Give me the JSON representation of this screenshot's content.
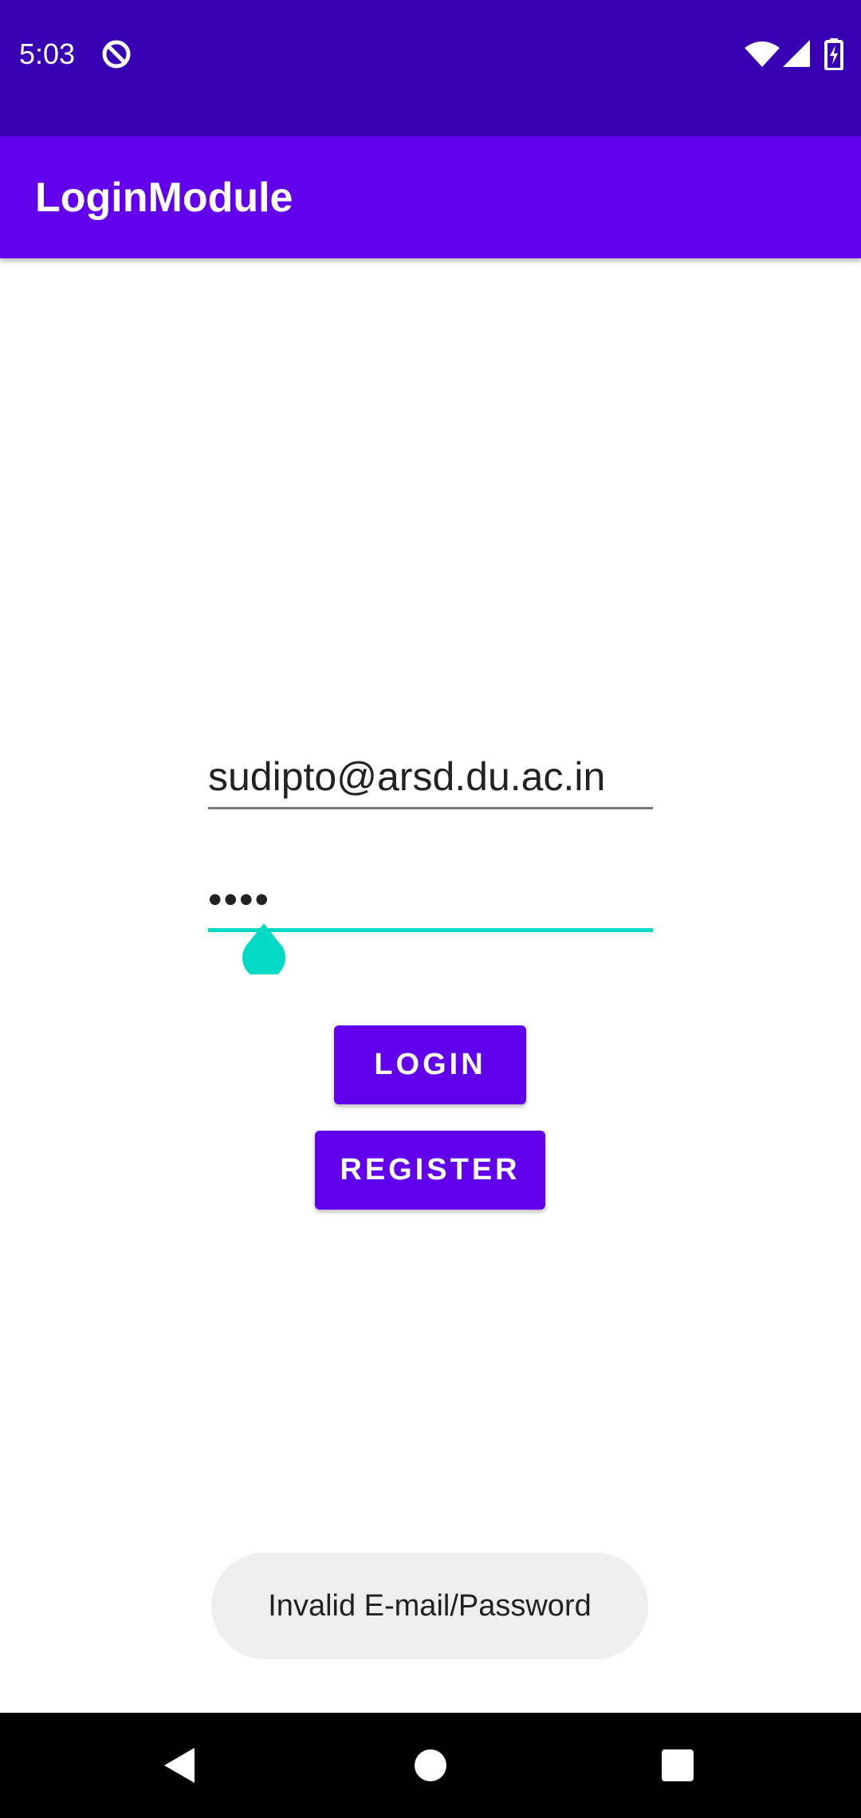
{
  "status_bar": {
    "time": "5:03",
    "icons": [
      "do-not-disturb-icon",
      "wifi-icon",
      "signal-icon",
      "battery-charging-icon"
    ],
    "background": "#3700b3"
  },
  "app_bar": {
    "title": "LoginModule",
    "background": "#6200ee"
  },
  "login_form": {
    "email_value": "sudipto@arsd.du.ac.in",
    "password_masked": "••••",
    "login_label": "LOGIN",
    "register_label": "REGISTER",
    "accent_color": "#03dac5",
    "button_color": "#6200ee"
  },
  "toast": {
    "message": "Invalid E-mail/Password"
  },
  "nav_bar": {
    "buttons": [
      "back-icon",
      "home-icon",
      "recents-icon"
    ]
  }
}
